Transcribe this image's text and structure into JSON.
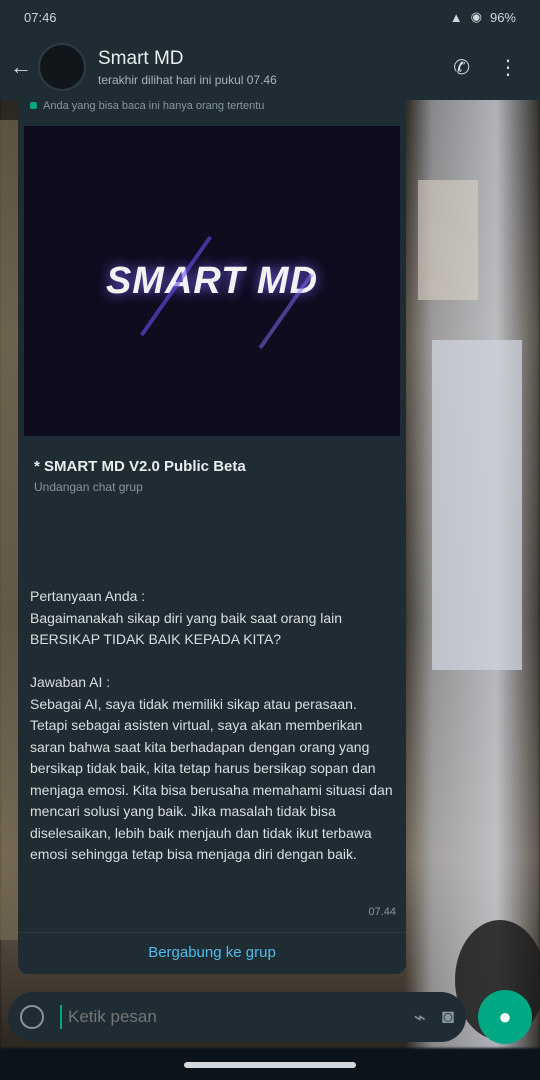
{
  "status_bar": {
    "time": "07:46",
    "battery": "96%"
  },
  "header": {
    "title": "Smart MD",
    "subtitle": "terakhir dilihat hari ini pukul 07.46"
  },
  "message": {
    "forward_note": "Anda yang bisa baca ini hanya orang tertentu",
    "preview_logo": "SMART MD",
    "link_title": "* SMART MD V2.0 Public Beta",
    "link_subtitle": "Undangan chat grup",
    "body": "Pertanyaan Anda :\nBagaimanakah sikap diri yang baik saat orang lain BERSIKAP TIDAK BAIK KEPADA KITA?\n\nJawaban AI :\nSebagai AI, saya tidak memiliki sikap atau perasaan. Tetapi sebagai asisten virtual, saya akan memberikan saran bahwa saat kita berhadapan dengan orang yang bersikap tidak baik, kita tetap harus bersikap sopan dan menjaga emosi. Kita bisa berusaha memahami situasi dan mencari solusi yang baik. Jika masalah tidak bisa diselesaikan, lebih baik menjauh dan tidak ikut terbawa emosi sehingga tetap bisa menjaga diri dengan baik.",
    "time": "07.44",
    "join_label": "Bergabung ke grup"
  },
  "input": {
    "placeholder": "Ketik pesan"
  }
}
